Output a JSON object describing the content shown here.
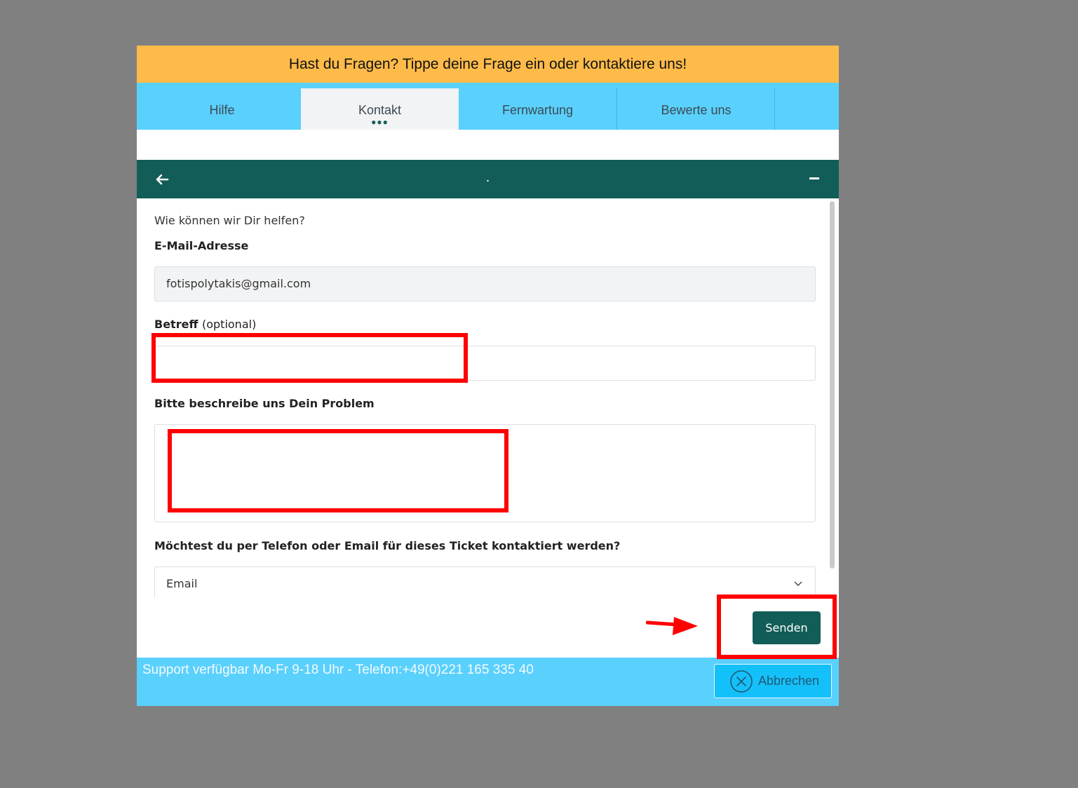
{
  "banner": {
    "text": "Hast du Fragen? Tippe deine Frage ein oder kontaktiere uns!"
  },
  "tabs": [
    {
      "label": "Hilfe",
      "active": false
    },
    {
      "label": "Kontakt",
      "active": true,
      "indicator": "●●●"
    },
    {
      "label": "Fernwartung",
      "active": false
    },
    {
      "label": "Bewerte uns",
      "active": false
    }
  ],
  "header": {
    "title": "."
  },
  "form": {
    "intro": "Wie können wir Dir helfen?",
    "email_label": "E-Mail-Adresse",
    "email_value": "fotispolytakis@gmail.com",
    "subject_label": "Betreff",
    "subject_optional": "(optional)",
    "subject_value": "",
    "problem_label": "Bitte beschreibe uns Dein Problem",
    "problem_value": "",
    "contact_label": "Möchtest du per Telefon oder Email für dieses Ticket kontaktiert werden?",
    "contact_selected": "Email"
  },
  "actions": {
    "send_label": "Senden",
    "cancel_label": "Abbrechen"
  },
  "footer": {
    "support_text": "Support verfügbar Mo-Fr 9-18 Uhr  - Telefon:+49(0)221 165 335 40"
  },
  "colors": {
    "banner": "#ffbb4a",
    "tabbar": "#5ad0fc",
    "header": "#135d58",
    "send_button": "#135d58",
    "cancel_button": "#14c0f9",
    "annotation": "#ff0000",
    "backdrop": "#808080"
  },
  "icons": [
    "back-arrow-icon",
    "minimize-icon",
    "chevron-down-icon",
    "close-circle-icon",
    "annotation-arrow"
  ]
}
